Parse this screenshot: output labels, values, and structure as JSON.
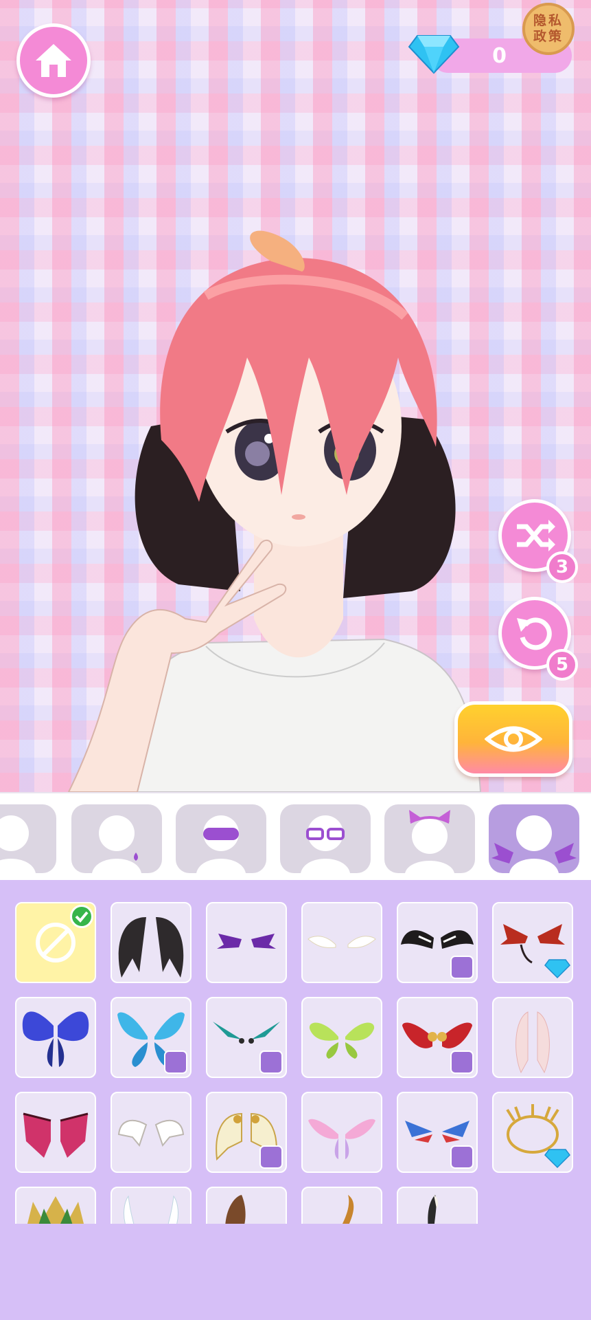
{
  "hud": {
    "gem_count": "0",
    "privacy_label": "隐私政策",
    "shuffle_count": "3",
    "undo_count": "5"
  },
  "icons": {
    "home": "home-icon",
    "gem": "diamond-icon",
    "shuffle": "shuffle-icon",
    "undo": "undo-icon",
    "preview": "eye-icon"
  },
  "colors": {
    "accent_pink": "#f48ad6",
    "panel_purple": "#d6bff7",
    "active_tab": "#b79de0",
    "preview_button": "#ffc233"
  },
  "category_tabs": [
    {
      "name": "hair-back-category",
      "selected": false
    },
    {
      "name": "earring-category",
      "selected": false
    },
    {
      "name": "eye-mask-category",
      "selected": false
    },
    {
      "name": "glasses-category",
      "selected": false
    },
    {
      "name": "headwear-category",
      "selected": false
    },
    {
      "name": "wings-category",
      "selected": true
    }
  ],
  "items": [
    {
      "kind": "none",
      "selected": true,
      "locked": false,
      "gem": false
    },
    {
      "kind": "black-feather-wings",
      "selected": false,
      "locked": false,
      "gem": false
    },
    {
      "kind": "small-purple-bat-wings",
      "selected": false,
      "locked": false,
      "gem": false
    },
    {
      "kind": "small-white-wings",
      "selected": false,
      "locked": false,
      "gem": false
    },
    {
      "kind": "black-white-wings",
      "selected": false,
      "locked": true,
      "gem": false
    },
    {
      "kind": "red-demon-wings",
      "selected": false,
      "locked": false,
      "gem": true
    },
    {
      "kind": "blue-butterfly-wings",
      "selected": false,
      "locked": false,
      "gem": false
    },
    {
      "kind": "cyan-fairy-wings",
      "selected": false,
      "locked": true,
      "gem": false
    },
    {
      "kind": "teal-mech-wings",
      "selected": false,
      "locked": true,
      "gem": false
    },
    {
      "kind": "green-fairy-wings",
      "selected": false,
      "locked": false,
      "gem": false
    },
    {
      "kind": "red-gold-wings",
      "selected": false,
      "locked": true,
      "gem": false
    },
    {
      "kind": "pink-feather-wings",
      "selected": false,
      "locked": false,
      "gem": false
    },
    {
      "kind": "crimson-bat-wings",
      "selected": false,
      "locked": false,
      "gem": false
    },
    {
      "kind": "white-line-wings",
      "selected": false,
      "locked": false,
      "gem": false
    },
    {
      "kind": "gold-armor-wings",
      "selected": false,
      "locked": true,
      "gem": false
    },
    {
      "kind": "pink-fairy-wings",
      "selected": false,
      "locked": false,
      "gem": false
    },
    {
      "kind": "blue-red-mini-wings",
      "selected": false,
      "locked": true,
      "gem": false
    },
    {
      "kind": "gold-halo-ring",
      "selected": false,
      "locked": false,
      "gem": true
    },
    {
      "kind": "gold-green-crown",
      "selected": false,
      "locked": false,
      "gem": false
    },
    {
      "kind": "white-horns",
      "selected": false,
      "locked": false,
      "gem": false
    },
    {
      "kind": "brown-ears",
      "selected": false,
      "locked": false,
      "gem": false
    },
    {
      "kind": "fox-tail",
      "selected": false,
      "locked": false,
      "gem": false
    },
    {
      "kind": "dark-tail",
      "selected": false,
      "locked": false,
      "gem": false
    }
  ]
}
